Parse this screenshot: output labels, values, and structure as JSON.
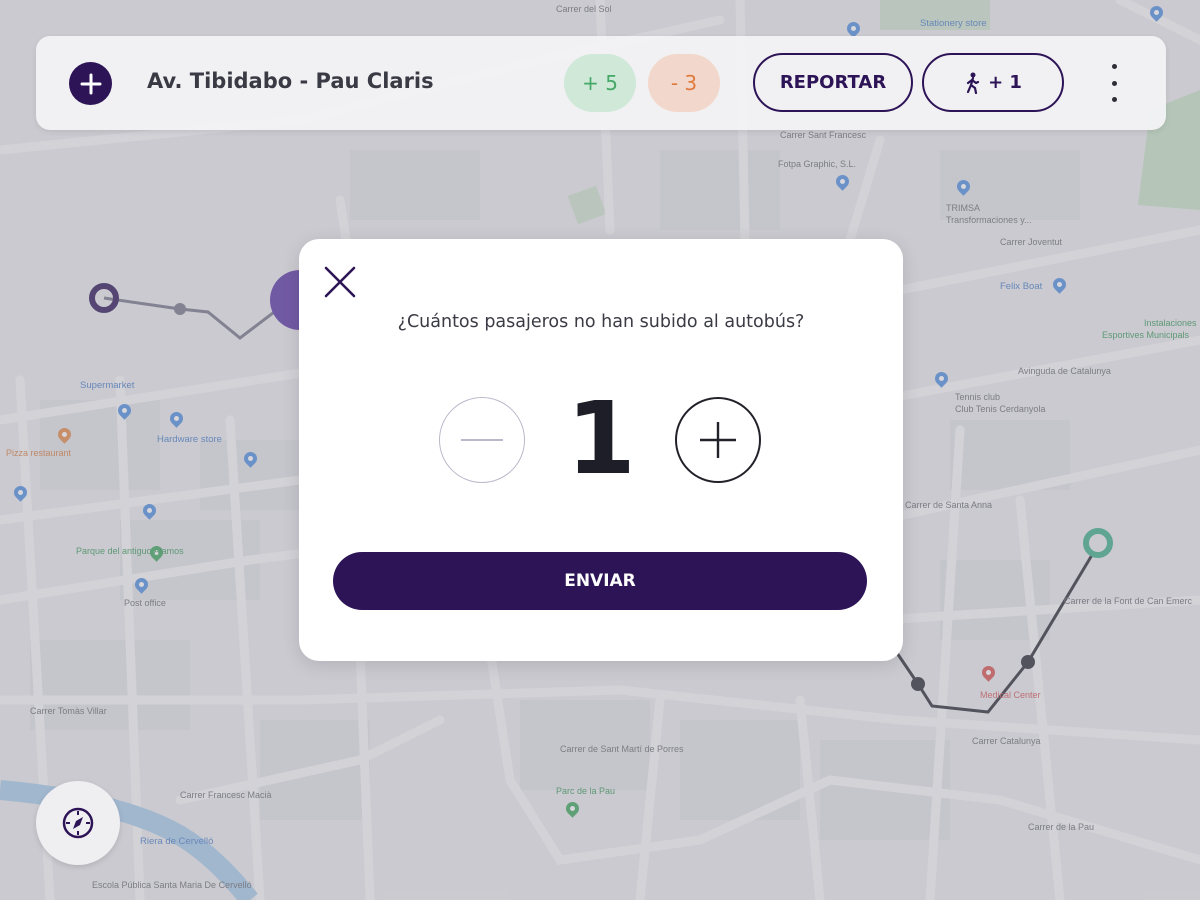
{
  "header": {
    "route_title": "Av. Tibidabo - Pau Claris",
    "boarded_count": "+ 5",
    "missed_count": "- 3",
    "report_label": "REPORTAR",
    "walker_count": "+ 1"
  },
  "dialog": {
    "question": "¿Cuántos pasajeros no han subido al autobús?",
    "count": "1",
    "submit_label": "ENVIAR"
  },
  "map": {
    "labels": [
      "Carrer del Sol",
      "Stationery store",
      "Fotpa Graphic, S.L.",
      "TRIMSA",
      "Transformaciones y...",
      "Carrer Joventut",
      "Felix Boat",
      "Instalaciones",
      "Esportives Municipals",
      "Avinguda de Catalunya",
      "Tennis club",
      "Club Tenis Cerdanyola",
      "Carrer de Santa Anna",
      "Supermarket",
      "Hardware store",
      "Pizza restaurant",
      "Parque del antiguo Alamos",
      "Post office",
      "Carrer Tomàs Villar",
      "Carrer de Sant Martí de Porres",
      "Parc de la Pau",
      "Carrer de la Pau",
      "Carrer Catalunya",
      "Medical Center",
      "Carrer de la Font de Can Emerc",
      "Carrer Francesc Macià",
      "Escola Pública Santa Maria De Cervelló",
      "Carrer Sant Francesc",
      "Riera de Cervelló"
    ]
  },
  "colors": {
    "brand": "#2d1457",
    "positive": "#44a866",
    "negative": "#e07a3c",
    "route_end": "#3fae8a"
  },
  "icons": {
    "add": "plus-icon",
    "walker": "pedestrian-icon",
    "more": "kebab-menu-icon",
    "compass": "compass-icon",
    "close": "close-icon",
    "decrement": "minus-icon",
    "increment": "plus-icon"
  }
}
